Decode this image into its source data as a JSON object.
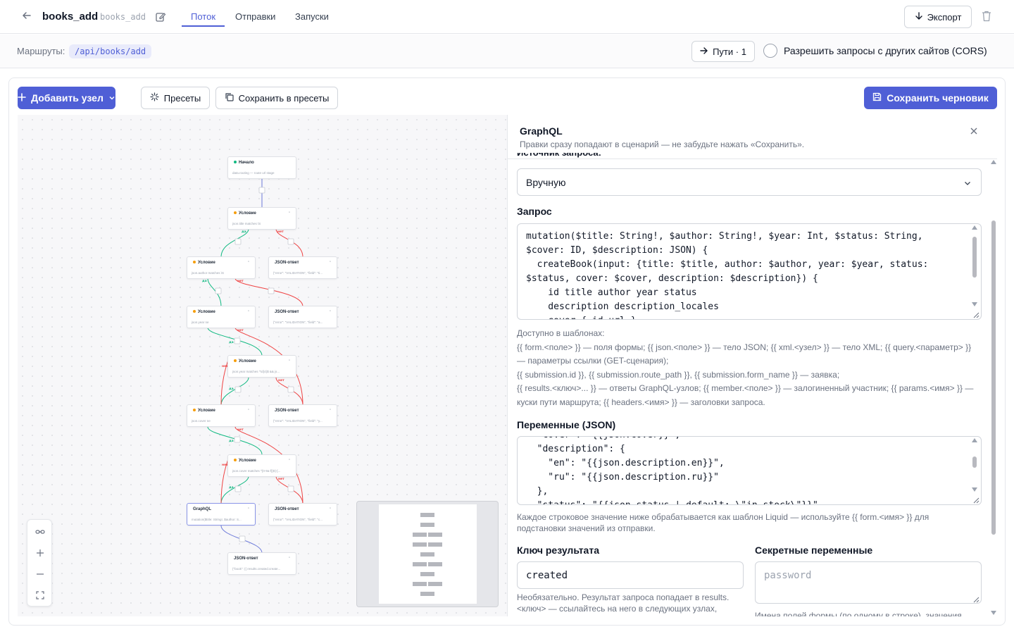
{
  "header": {
    "title": "books_add",
    "slug": "books_add",
    "tabs": [
      {
        "label": "Поток",
        "active": true
      },
      {
        "label": "Отправки",
        "active": false
      },
      {
        "label": "Запуски",
        "active": false
      }
    ],
    "export_label": "Экспорт"
  },
  "routes": {
    "label": "Маршруты:",
    "path": "/api/books/add",
    "paths_button": "Пути · 1",
    "cors_label": "Разрешить запросы с других сайтов (CORS)",
    "cors_checked": false
  },
  "toolbar": {
    "add_node": "Добавить узел",
    "presets": "Пресеты",
    "save_to_presets": "Сохранить в пресеты",
    "save_draft": "Сохранить черновик"
  },
  "colors": {
    "accent": "#4f5fd6",
    "yes_edge": "#10b981",
    "no_edge": "#ef4444",
    "edge": "#6b79d9"
  },
  "canvas": {
    "nodes": [
      {
        "type": "Начало",
        "summary": "data.routing — route url stage",
        "dot": "green"
      },
      {
        "type": "Условие",
        "summary": "json.title matches \\S",
        "dot": "amber"
      },
      {
        "type": "Условие",
        "summary": "json.author matches \\S",
        "dot": "amber"
      },
      {
        "type": "JSON-ответ",
        "summary": "{\"error\": \"VALIDATION\", \"field\": \"ti...",
        "dot": "none"
      },
      {
        "type": "Условие",
        "summary": "json.year ne",
        "dot": "amber"
      },
      {
        "type": "JSON-ответ",
        "summary": "{\"error\": \"VALIDATION\", \"field\": \"a...",
        "dot": "none"
      },
      {
        "type": "Условие",
        "summary": "json.year matches ^\\d{4}$ && js...",
        "dot": "amber"
      },
      {
        "type": "Условие",
        "summary": "json.cover ne",
        "dot": "amber"
      },
      {
        "type": "JSON-ответ",
        "summary": "{\"error\": \"VALIDATION\", \"field\": \"y...",
        "dot": "none"
      },
      {
        "type": "Условие",
        "summary": "json.cover matches ^[0-9a-f]{8}-[...",
        "dot": "amber"
      },
      {
        "type": "GraphQL",
        "summary": "mutation($title: String!, $author: S...",
        "dot": "none"
      },
      {
        "type": "JSON-ответ",
        "summary": "{\"error\": \"VALIDATION\", \"field\": \"c...",
        "dot": "none"
      },
      {
        "type": "JSON-ответ",
        "summary": "{\"book\": {{ results.created.create...",
        "dot": "none"
      }
    ],
    "yes_label": "да",
    "no_label": "нет"
  },
  "panel": {
    "title": "GraphQL",
    "subtitle": "Правки сразу попадают в сценарий — не забудьте нажать «Сохранить».",
    "source_label": "Источник запроса:",
    "source_value": "Вручную",
    "query_label": "Запрос",
    "query_text": "mutation($title: String!, $author: String!, $year: Int, $status: String,\n$cover: ID, $description: JSON) {\n  createBook(input: {title: $title, author: $author, year: $year, status:\n$status, cover: $cover, description: $description}) {\n    id title author year status\n    description description_locales\n    cover { id url }",
    "templates_help": "Доступно в шаблонах:\n{{ form.<поле> }} — поля формы; {{ json.<поле> }} — тело JSON; {{ xml.<узел> }} — тело XML; {{ query.<параметр> }} — параметры ссылки (GET-сценария);\n{{ submission.id }}, {{ submission.route_path }}, {{ submission.form_name }} — заявка;\n{{ results.<ключ>... }} — ответы GraphQL-узлов; {{ member.<поле> }} — залогиненный участник; {{ params.<имя> }} — куски пути маршрута; {{ headers.<имя> }} — заголовки запроса.",
    "variables_label": "Переменные (JSON)",
    "variables_text": "  \"cover\": \"{{json.cover}}\",\n  \"description\": {\n    \"en\": \"{{json.description.en}}\",\n    \"ru\": \"{{json.description.ru}}\"\n  },\n  \"status\": \"{{json.status | default: \\\"in_stock\\\"}}\"",
    "variables_help": "Каждое строковое значение ниже обрабатывается как шаблон Liquid — используйте {{ form.<имя> }} для подстановки значений из отправки.",
    "result_key_label": "Ключ результата",
    "result_key_value": "created",
    "result_key_help": "Необязательно. Результат запроса попадает в results.<ключ> — ссылайтесь на него в следующих узлах,",
    "secrets_label": "Секретные переменные",
    "secrets_placeholder": "password",
    "secrets_help": "Имена полей формы (по одному в строке), значения"
  }
}
